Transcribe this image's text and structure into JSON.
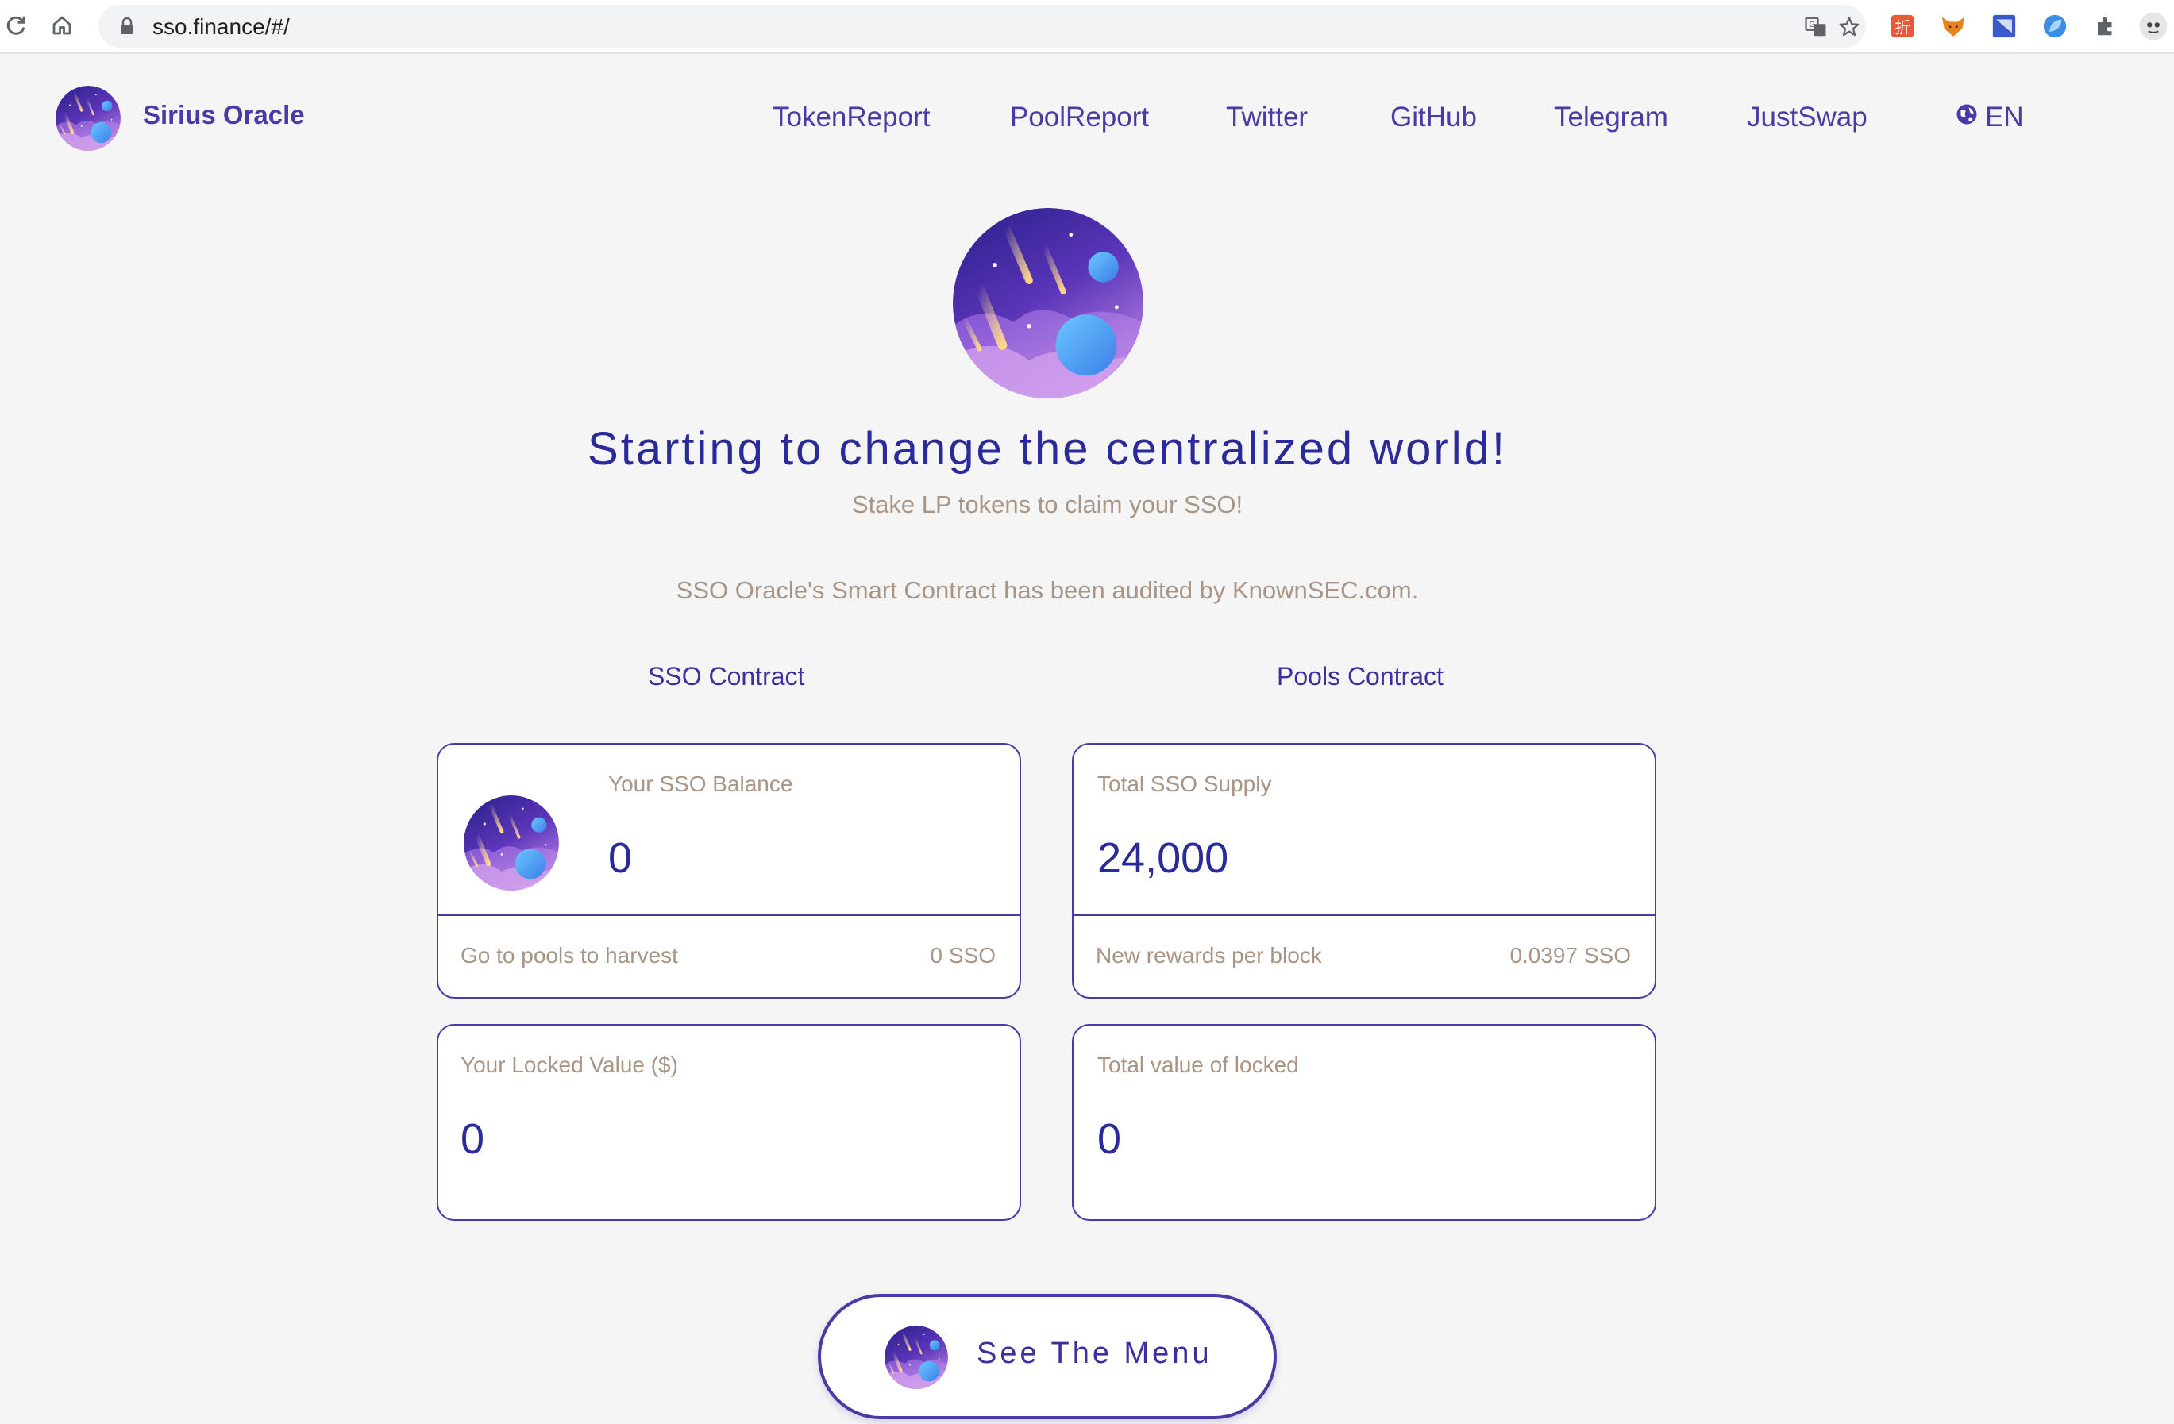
{
  "browser": {
    "url": "sso.finance/#/"
  },
  "site": {
    "brand": "Sirius Oracle",
    "nav": [
      "TokenReport",
      "PoolReport",
      "Twitter",
      "GitHub",
      "Telegram",
      "JustSwap"
    ],
    "language": "EN"
  },
  "hero": {
    "headline": "Starting to change the centralized world!",
    "subtitle": "Stake LP tokens to claim your SSO!",
    "audit_note": "SSO Oracle's Smart Contract has been audited by KnownSEC.com.",
    "sso_contract_link": "SSO Contract",
    "pools_contract_link": "Pools Contract"
  },
  "cards": {
    "balance": {
      "label": "Your SSO Balance",
      "value": "0",
      "footer_label": "Go to pools to harvest",
      "footer_value": "0 SSO"
    },
    "supply": {
      "label": "Total SSO Supply",
      "value": "24,000",
      "footer_label": "New rewards per block",
      "footer_value": "0.0397 SSO"
    },
    "locked": {
      "label": "Your Locked Value ($)",
      "value": "0"
    },
    "total_locked": {
      "label": "Total value of locked",
      "value": "0"
    }
  },
  "menu_button": {
    "label": "See The Menu"
  },
  "colors": {
    "accent": "#4a3aa6",
    "heading": "#2a2a9a",
    "muted": "#a89585",
    "background": "#f5f5f5"
  },
  "icons": [
    "reload-icon",
    "home-icon",
    "lock-icon",
    "translate-icon",
    "star-icon",
    "extension-icons",
    "sirius-logo"
  ]
}
